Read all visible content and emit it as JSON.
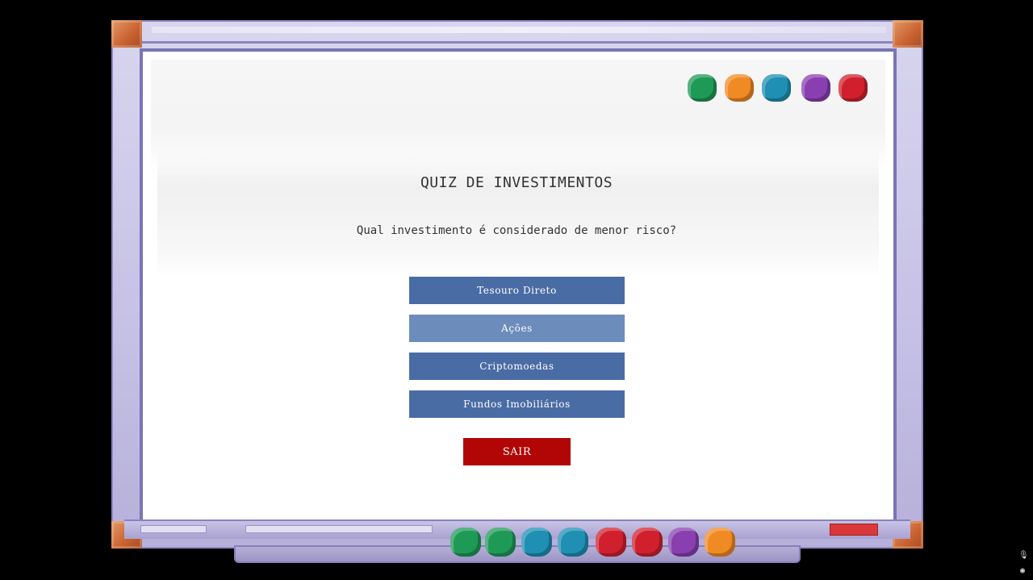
{
  "quiz": {
    "title": "QUIZ DE INVESTIMENTOS",
    "question": "Qual investimento é considerado de menor risco?",
    "answers": [
      {
        "label": "Tesouro Direto",
        "hovered": false
      },
      {
        "label": "Ações",
        "hovered": true
      },
      {
        "label": "Criptomoedas",
        "hovered": false
      },
      {
        "label": "Fundos Imobiliários",
        "hovered": false
      }
    ],
    "exit_label": "SAIR"
  },
  "colors": {
    "answer_button": "#4a6ca5",
    "answer_button_hover": "#6c8cbc",
    "exit_button": "#b20606",
    "board_surface": "#ffffff",
    "frame": "#c7c2e6",
    "frame_corner": "#c8612f"
  },
  "gems_top": [
    {
      "name": "green-gem-icon",
      "color": "#1f9a56"
    },
    {
      "name": "orange-gem-icon",
      "color": "#f08a24"
    },
    {
      "name": "teal-gem-icon",
      "color": "#1f8fb4"
    },
    {
      "name": "purple-gem-icon",
      "color": "#8a3fb0"
    },
    {
      "name": "red-gem-icon",
      "color": "#d0202e"
    }
  ],
  "gems_bottom": [
    {
      "name": "green-gem-icon",
      "color": "#1f9a56"
    },
    {
      "name": "green-gem-icon",
      "color": "#1f9a56"
    },
    {
      "name": "teal-gem-icon",
      "color": "#1f8fb4"
    },
    {
      "name": "teal-gem-icon",
      "color": "#1f8fb4"
    },
    {
      "name": "red-gem-icon",
      "color": "#d0202e"
    },
    {
      "name": "red-gem-icon",
      "color": "#d0202e"
    },
    {
      "name": "purple-gem-icon",
      "color": "#8a3fb0"
    },
    {
      "name": "orange-gem-icon",
      "color": "#f08a24"
    }
  ],
  "status_icons": [
    {
      "name": "microphone-icon",
      "glyph": "🎙"
    },
    {
      "name": "record-icon",
      "glyph": "◉"
    }
  ]
}
